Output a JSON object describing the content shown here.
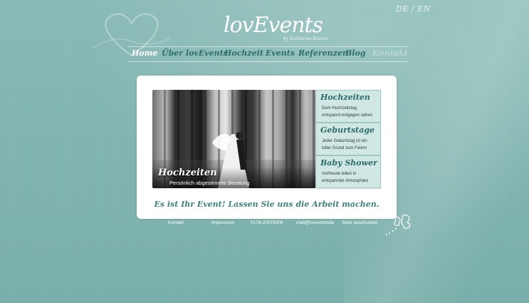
{
  "language": {
    "de": "DE",
    "separator": "/",
    "en": "EN"
  },
  "logo": {
    "text": "lovEvents",
    "subtitle": "by Katharina Ramos"
  },
  "nav": [
    {
      "label": "Home"
    },
    {
      "label": "Über lovEvents"
    },
    {
      "label": "Hochzeit"
    },
    {
      "label": "Events"
    },
    {
      "label": "Referenzen"
    },
    {
      "label": "Blog"
    },
    {
      "label": "Kontakt"
    }
  ],
  "hero": {
    "title": "Hochzeiten",
    "subtitle": "Persönlich abgestimmte Beratung"
  },
  "tiles": [
    {
      "title": "Hochzeiten",
      "line1": "Dem Hochzeitstag",
      "line2": "entspannt entgegen sehen"
    },
    {
      "title": "Geburtstage",
      "line1": "Jeder Geburtstag ist ein",
      "line2": "toller Grund zum Feiern"
    },
    {
      "title": "Baby Shower",
      "line1": "Vorfreude teilen in",
      "line2": "entspannter Atmosphäre"
    }
  ],
  "slogan": "Es ist Ihr Event! Lassen Sie uns die Arbeit machen.",
  "footer": {
    "kontakt": "Kontakt",
    "impressum": "Impressum",
    "phone": "0176-20079308",
    "email": "mail@loveventsde",
    "print": "Seite ausdrucken"
  },
  "colors": {
    "background": "#7fb3ae",
    "accent": "#2f6f6a",
    "slogan": "#3f837d"
  }
}
